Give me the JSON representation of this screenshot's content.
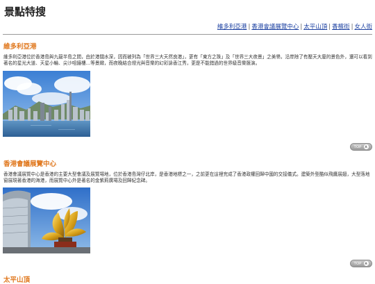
{
  "page": {
    "title": "景點特搜"
  },
  "nav": {
    "links": [
      "維多利亞港",
      "香港會議展覽中心",
      "太平山頂",
      "香檳街",
      "女人街"
    ],
    "separator": "|"
  },
  "sections": [
    {
      "title": "維多利亞港",
      "text": "維多利亞港位於香港島與九龍半島之間，由於港闊水深，因而被列為「世界三大天然良港」，更有「東方之珠」及「世界三大夜景」之美譽。沿岸除了有壓天大廈的景色外，還可以看到著名的星光大道、天星小輪、尖沙咀鐘樓…等景緻，而夜晚結合燈光與音樂的幻彩詠香江秀，更是不能錯過的世界級音樂匯演。",
      "top_label": "TOP"
    },
    {
      "title": "香港會議展覽中心",
      "text": "香港會議展覽中心是香港的主要大型會議及展覽場地，位於香港島灣仔北岸，是香港地標之一，之前更在這裡完成了香港政權回歸中國的交接儀式。建築外型酷似飛鷹展翅，大型落地窗展現著香港的海港，而展覽中心外是著名的金紫荊廣場及回歸紀念碑。",
      "top_label": "TOP"
    },
    {
      "title": "太平山頂"
    }
  ],
  "colors": {
    "section_title": "#e0781e",
    "link": "#1a3fa0",
    "rule": "#999999"
  }
}
